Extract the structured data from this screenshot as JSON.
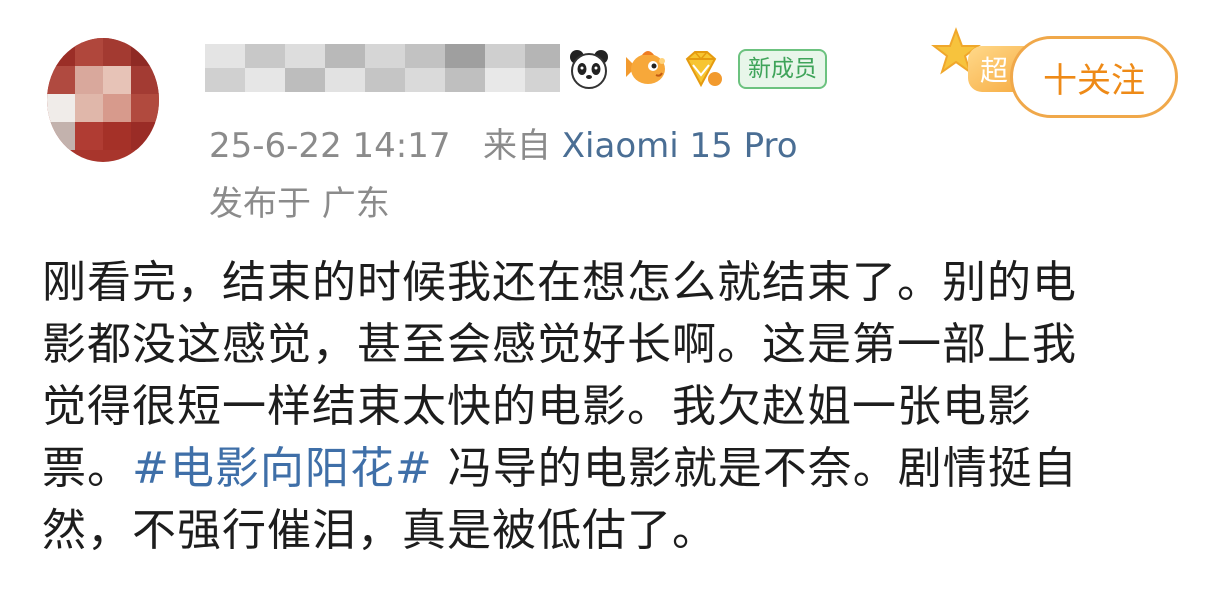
{
  "post": {
    "timestamp": "25-6-22 14:17",
    "source_prefix": "来自",
    "device": "Xiaomi 15 Pro",
    "location": "发布于 广东",
    "new_member_badge": "新成员",
    "follow_label": "十关注",
    "super_badge_char": "超",
    "body_lines": [
      "刚看完，结束的时候我还在想怎么就结束了。别的电",
      "影都没这感觉，甚至会感觉好长啊。这是第一部上我",
      "觉得很短一样结束太快的电影。我欠赵姐一张电影"
    ],
    "body_line4_before": "票。",
    "hashtag": "#电影向阳花#",
    "body_line4_after": " 冯导的电影就是不奈。剧情挺自",
    "body_line5": "然，不强行催泪，真是被低估了。"
  },
  "icons": [
    "panda-icon",
    "fish-icon",
    "diamond-icon",
    "star-icon"
  ],
  "colors": {
    "follow": "#ee8a17",
    "hashtag": "#3f6fa8",
    "meta": "#8b8b8b",
    "new_member": "#3fa45a"
  }
}
